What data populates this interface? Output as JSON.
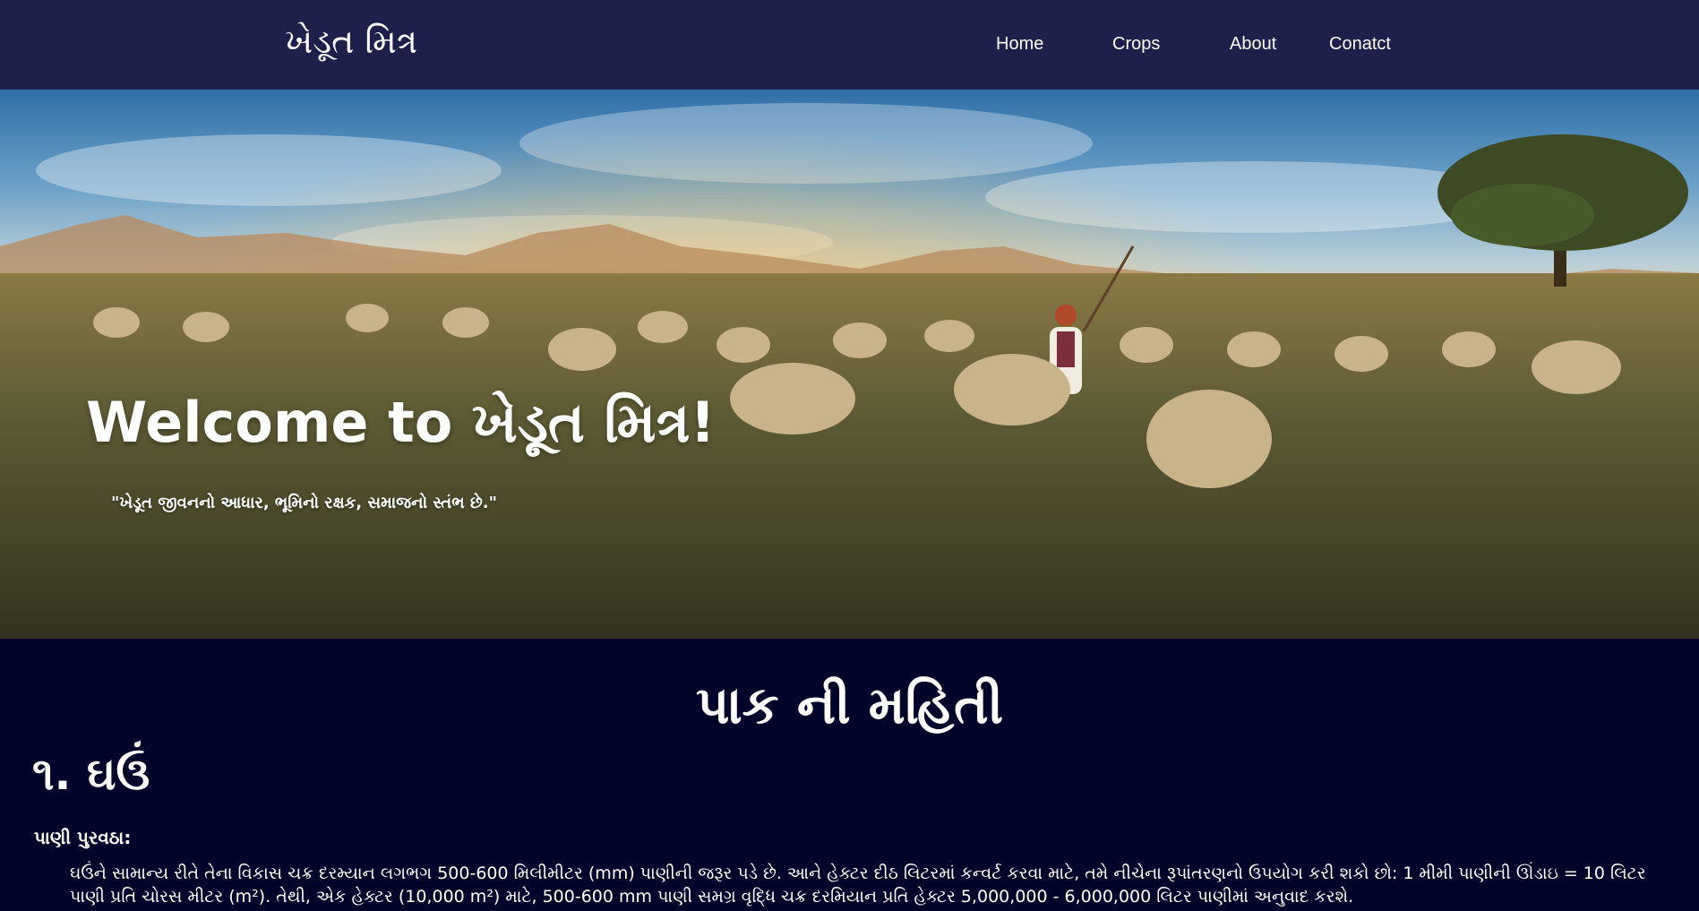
{
  "nav": {
    "brand": "ખેડૂત મિત્ર",
    "links": [
      "Home",
      "Crops",
      "About",
      "Conatct"
    ]
  },
  "hero": {
    "title": "Welcome to ખેડૂત મિત્ર!",
    "quote": "\"ખેડૂત જીવનનો આધાર, ભૂમિનો રક્ષક, સમાજનો સ્તંભ છે.\""
  },
  "crops_section": {
    "title": "પાક ની મહિતી",
    "crop_1": {
      "heading": "૧. ઘઉં",
      "water_label": "પાણી પુરવઠા:",
      "water_text": "ઘઉંને સામાન્ય રીતે તેના વિકાસ ચક્ર દરમ્યાન લગભગ 500-600 મિલીમીટર (mm) પાણીની જરૂર પડે છે. આને હેક્ટર દીઠ લિટરમાં કન્વર્ટ કરવા માટે, તમે નીચેના રૂપાંતરણનો ઉપયોગ કરી શકો છો: 1 મીમી પાણીની ઊંડાઇ = 10 લિટર પાણી પ્રતિ ચોરસ મીટર (m²). તેથી, એક હેક્ટર (10,000 m²) માટે, 500-600 mm પાણી સમગ્ર વૃદ્ધિ ચક્ર દરમિયાન પ્રતિ હેક્ટર 5,000,000 - 6,000,000 લિટર પાણીમાં અનુવાદ કરશે."
    }
  },
  "colors": {
    "navbar_bg": "#1e1f4a",
    "page_bg": "#03042a",
    "text": "#ffffff"
  },
  "icons": {
    "hero_image": "pastoral-sheep-herding-sunset-scene"
  }
}
